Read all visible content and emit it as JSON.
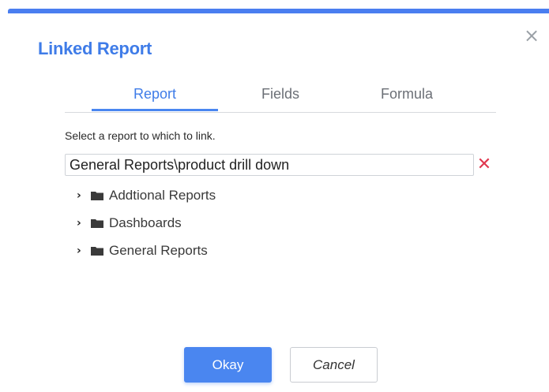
{
  "dialog": {
    "title": "Linked Report",
    "close_icon": "close-icon",
    "accent_color": "#4a86f0",
    "title_color": "#3f7ce8"
  },
  "tabs": [
    {
      "label": "Report",
      "active": true
    },
    {
      "label": "Fields",
      "active": false
    },
    {
      "label": "Formula",
      "active": false
    }
  ],
  "report_picker": {
    "instruction": "Select a report to which to link.",
    "value": "General Reports\\product drill down",
    "clear_icon": "clear-x-icon",
    "clear_color": "#e0384f"
  },
  "tree": {
    "items": [
      {
        "label": "Addtional Reports",
        "icon": "folder-icon",
        "expand_icon": "chevron-right-icon"
      },
      {
        "label": "Dashboards",
        "icon": "folder-icon",
        "expand_icon": "chevron-right-icon"
      },
      {
        "label": "General Reports",
        "icon": "folder-icon",
        "expand_icon": "chevron-right-icon"
      }
    ]
  },
  "buttons": {
    "okay_label": "Okay",
    "cancel_label": "Cancel"
  }
}
